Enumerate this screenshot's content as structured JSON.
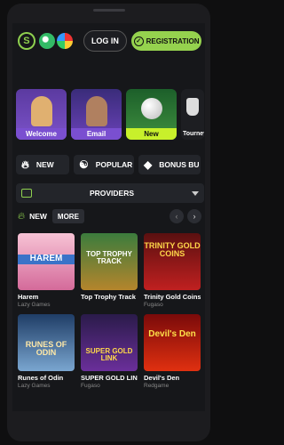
{
  "header": {
    "logo_letter": "S",
    "login_label": "LOG IN",
    "register_label": "REGISTRATION"
  },
  "promos": [
    {
      "label": "Welcome"
    },
    {
      "label": "Email"
    },
    {
      "label": "New"
    },
    {
      "label": "Tourney"
    }
  ],
  "categories": [
    {
      "label": "NEW"
    },
    {
      "label": "POPULAR"
    },
    {
      "label": "BONUS BU"
    }
  ],
  "providers_label": "PROVIDERS",
  "section": {
    "title": "NEW",
    "more_label": "MORE"
  },
  "games": [
    {
      "title": "Harem",
      "provider": "Lazy Games",
      "art_text": "HAREM"
    },
    {
      "title": "Top Trophy Track",
      "provider": "",
      "art_text": "TOP TROPHY TRACK"
    },
    {
      "title": "Trinity Gold Coins:",
      "provider": "Fugaso",
      "art_text": "TRINITY GOLD COINS"
    },
    {
      "title": "Runes of Odin",
      "provider": "Lazy Games",
      "art_text": "RUNES OF ODIN"
    },
    {
      "title": "SUPER GOLD LINK: ...",
      "provider": "Fugaso",
      "art_text": "SUPER GOLD LINK"
    },
    {
      "title": "Devil's Den",
      "provider": "Redgame",
      "art_text": "Devil's Den"
    }
  ],
  "colors": {
    "accent": "#95d24e",
    "promo_purple": "#7a4fd0",
    "promo_lime": "#c8f02b",
    "background": "#16171a"
  }
}
